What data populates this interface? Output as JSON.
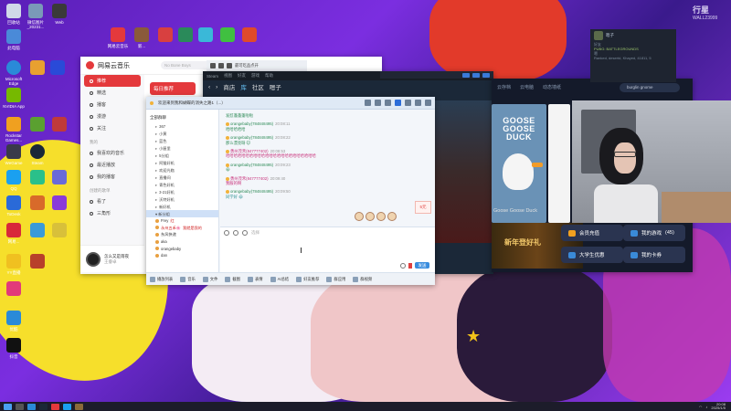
{
  "desktop": {
    "top_icons": [
      {
        "label": "回收站",
        "color": "#d0d8e8"
      },
      {
        "label": "微信图片_20231...",
        "color": "#7a9ab8"
      },
      {
        "label": "Web",
        "color": "#3a3a3a"
      },
      {
        "label": "网易云音乐",
        "color": "#e4393c"
      },
      {
        "label": "新...",
        "color": "#8a5a3a"
      }
    ],
    "left_icons": [
      {
        "label": "此电脑",
        "color": "#4a8ad8"
      },
      {
        "label": "Microsoft Edge",
        "color": "#2a8ad8"
      },
      {
        "label": "NVIDIA App",
        "color": "#76b900"
      },
      {
        "label": "Rockstar Games...",
        "color": "#f0a020"
      },
      {
        "label": "WeGame",
        "color": "#3a3a4a"
      },
      {
        "label": "Steam",
        "color": "#1b2838"
      },
      {
        "label": "QQ",
        "color": "#1aa0f0"
      },
      {
        "label": "ToDesk",
        "color": "#2a6ad8"
      },
      {
        "label": "网易...",
        "color": "#d8283a"
      },
      {
        "label": "YY直播",
        "color": "#f0c020"
      },
      {
        "label": "优酷",
        "color": "#2a8ad8"
      },
      {
        "label": "抖音",
        "color": "#111111"
      }
    ],
    "wallpaper_logo": "行星",
    "wallpaper_logo_sub": "WALL23999"
  },
  "netease": {
    "title": "网易云音乐",
    "search_placeholder": "No Bone Boys",
    "nav": [
      "推荐",
      "精选",
      "播客",
      "漫游",
      "关注"
    ],
    "section_mine": "我的",
    "mine_items": [
      "我喜欢的音乐",
      "最近播放",
      "我的播客"
    ],
    "section_playlist": "创建的歌单",
    "playlist_items": [
      "看了",
      "三角形"
    ],
    "daily_label": "每日推荐",
    "now_playing_title": "怎么又是雨夜",
    "now_playing_artist": "王睿卓"
  },
  "steam": {
    "top_labels": [
      "Steam",
      "视图",
      "好友",
      "游戏",
      "帮助"
    ],
    "nav": [
      "商店",
      "库",
      "社区",
      "嗯子"
    ],
    "active_nav": "库"
  },
  "qq": {
    "title": "欢迎来到我和蝴蝶的消失之路1（...）",
    "group_header": "全部群聊",
    "groups": [
      {
        "count": "▸",
        "name": "367"
      },
      {
        "count": "▸",
        "name": "小黄"
      },
      {
        "count": "▸",
        "name": "蓝色"
      },
      {
        "count": "▸",
        "name": "小屋里"
      },
      {
        "count": "▸",
        "name": "5分组"
      },
      {
        "count": "▸",
        "name": "阿猫好机"
      },
      {
        "count": "▸",
        "name": "欢迎光临"
      },
      {
        "count": "▸",
        "name": "直播间"
      },
      {
        "count": "▸",
        "name": "青色好机"
      },
      {
        "count": "▸",
        "name": "3-21好机"
      },
      {
        "count": "▸",
        "name": "沃特好机"
      },
      {
        "count": "▸",
        "name": "新好机"
      }
    ],
    "selected_group": "▾ 新分组",
    "members": [
      {
        "name": "Frey",
        "tag": "红",
        "red": false
      },
      {
        "name": "永州五禾🌸",
        "tag": "我就是我的",
        "red": true
      },
      {
        "name": "东风快递",
        "tag": "",
        "red": false
      },
      {
        "name": "aka",
        "tag": "",
        "red": false
      },
      {
        "name": "orangebaby",
        "tag": "",
        "red": false
      },
      {
        "name": "dan",
        "tag": "",
        "red": false
      }
    ],
    "messages": [
      {
        "who": "",
        "time": "",
        "body": "发怼蓬蓬蓬啦啦",
        "style": "green"
      },
      {
        "who": "orangebaby(784848495)",
        "time": "20:08:11",
        "body": "哈哈哈哈哈",
        "style": "green"
      },
      {
        "who": "orangebaby(784848495)",
        "time": "20:08:22",
        "body": "那么漂亮呀 🐱",
        "style": "green"
      },
      {
        "who": "勇州茂禾(847777402)",
        "time": "20:08:53",
        "body": "哈哈哈哈哈哈哈哈哈哈哈哈哈哈哈哈哈哈哈哈哈哈哈",
        "style": "pink"
      },
      {
        "who": "orangebaby(784848495)",
        "time": "20:09:23",
        "body": "😀",
        "style": "green"
      },
      {
        "who": "勇州茂禾(847777402)",
        "time": "20:09:40",
        "body": "我服的啊",
        "style": "pink"
      },
      {
        "who": "orangebaby(784848495)",
        "time": "20:09:50",
        "body": "同学好 😀",
        "style": "teal"
      }
    ],
    "input_placeholder": "选择",
    "send_label": "发送",
    "notice_tag": "5元",
    "bottom_buttons": [
      "播放列表",
      "音乐",
      "文件",
      "截图",
      "表情",
      "AI总结",
      "好友推荐",
      "群应用",
      "群视频"
    ]
  },
  "library": {
    "nav": [
      "云存档",
      "云电脑",
      "动态墙纸"
    ],
    "search_value": "burglin gnome",
    "game_title": "GOOSE GOOSE DUCK",
    "game_label": "Goose Goose Duck",
    "banner_text": "新年登好礼",
    "buttons": [
      {
        "label": "会员充值",
        "color": "#f0a020"
      },
      {
        "label": "我的游戏",
        "count": "(45)",
        "color": "#3a8ad8"
      },
      {
        "label": "大学生优惠",
        "color": "#3a8ad8"
      },
      {
        "label": "我的卡券",
        "color": "#3a8ad8"
      }
    ]
  },
  "friends_popup": {
    "name": "嗯子",
    "status": "好友",
    "game": "PUBG: BATTLEGROUNDS",
    "sub_name": "嗯",
    "detail": "Ranked, desertd, Khayed, 41811, 5"
  },
  "top_toolbar": {
    "label": "最可吃品点开",
    "right_label": "开始"
  },
  "taskbar": {
    "time": "20:08",
    "date": "2025/1/5"
  }
}
